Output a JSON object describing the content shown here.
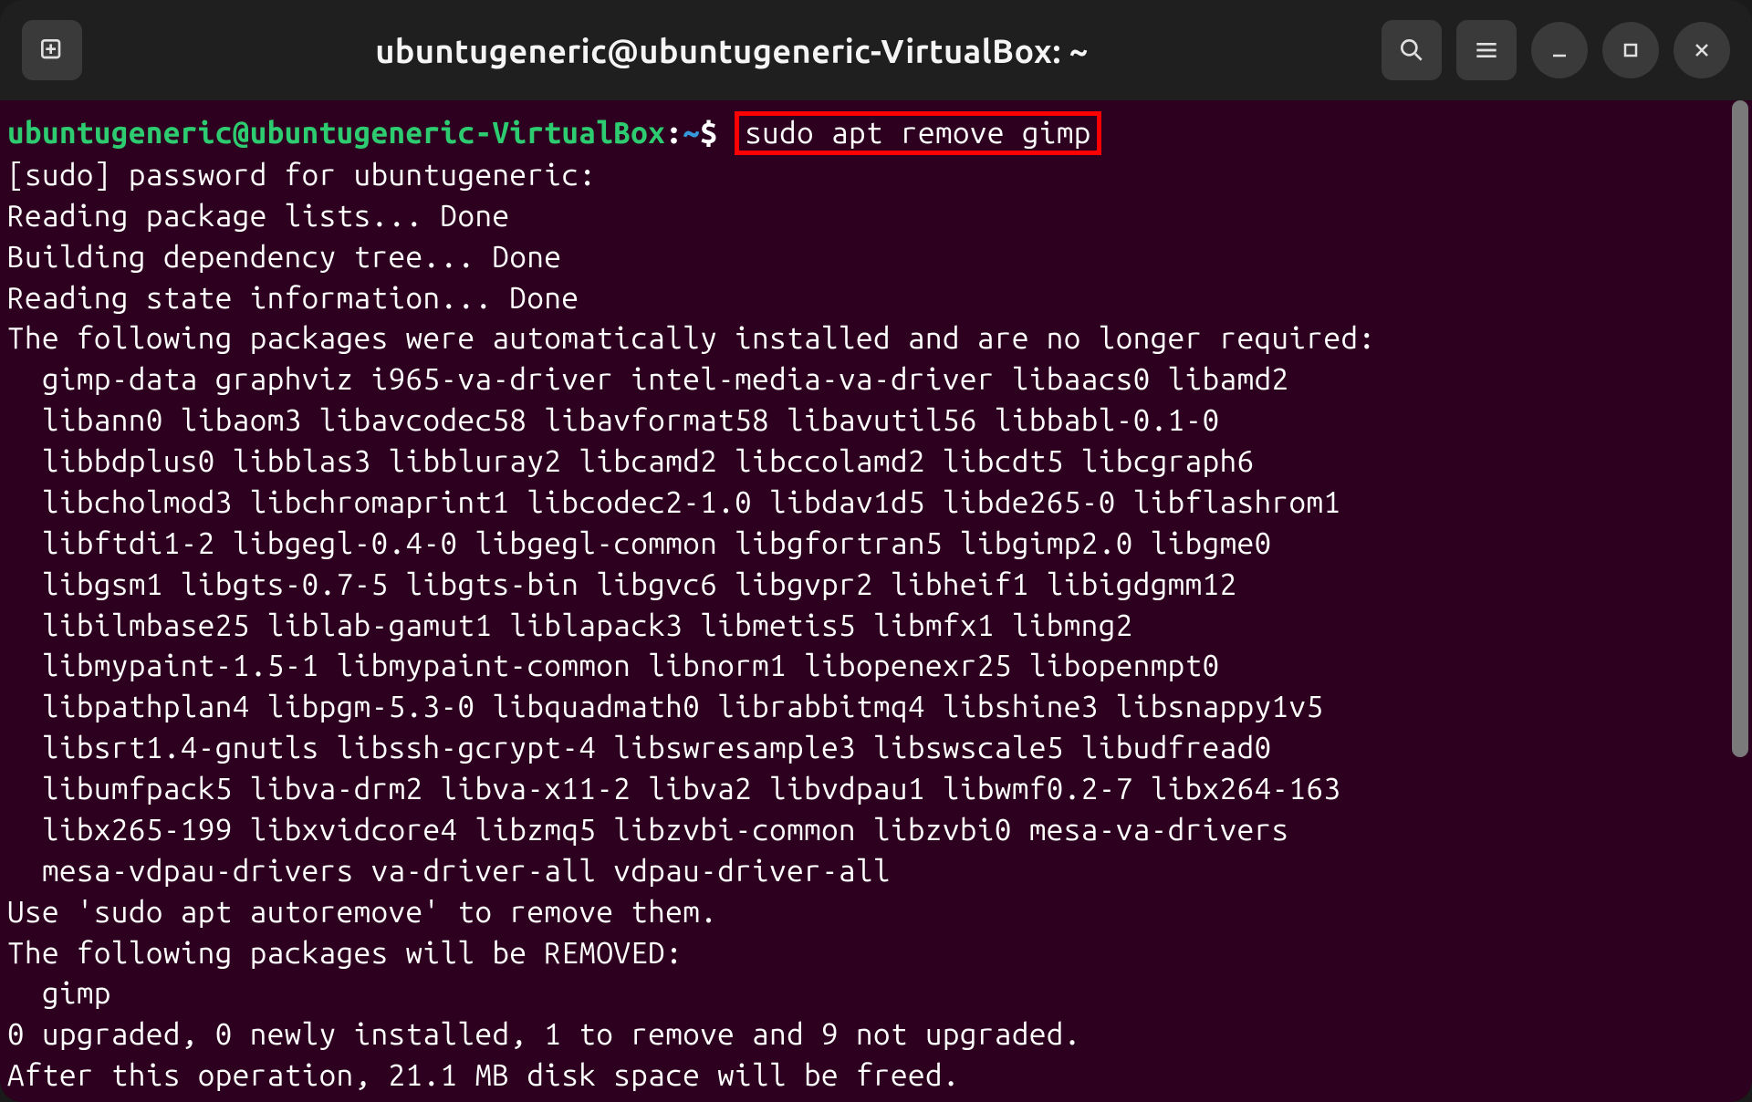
{
  "titlebar": {
    "title": "ubuntugeneric@ubuntugeneric-VirtualBox: ~"
  },
  "prompt": {
    "user_host": "ubuntugeneric@ubuntugeneric-VirtualBox",
    "colon": ":",
    "path": "~",
    "dollar": "$",
    "command": "sudo apt remove gimp"
  },
  "output": {
    "l1": "[sudo] password for ubuntugeneric:",
    "l2": "Reading package lists... Done",
    "l3": "Building dependency tree... Done",
    "l4": "Reading state information... Done",
    "l5": "The following packages were automatically installed and are no longer required:",
    "l6": "  gimp-data graphviz i965-va-driver intel-media-va-driver libaacs0 libamd2",
    "l7": "  libann0 libaom3 libavcodec58 libavformat58 libavutil56 libbabl-0.1-0",
    "l8": "  libbdplus0 libblas3 libbluray2 libcamd2 libccolamd2 libcdt5 libcgraph6",
    "l9": "  libcholmod3 libchromaprint1 libcodec2-1.0 libdav1d5 libde265-0 libflashrom1",
    "l10": "  libftdi1-2 libgegl-0.4-0 libgegl-common libgfortran5 libgimp2.0 libgme0",
    "l11": "  libgsm1 libgts-0.7-5 libgts-bin libgvc6 libgvpr2 libheif1 libigdgmm12",
    "l12": "  libilmbase25 liblab-gamut1 liblapack3 libmetis5 libmfx1 libmng2",
    "l13": "  libmypaint-1.5-1 libmypaint-common libnorm1 libopenexr25 libopenmpt0",
    "l14": "  libpathplan4 libpgm-5.3-0 libquadmath0 librabbitmq4 libshine3 libsnappy1v5",
    "l15": "  libsrt1.4-gnutls libssh-gcrypt-4 libswresample3 libswscale5 libudfread0",
    "l16": "  libumfpack5 libva-drm2 libva-x11-2 libva2 libvdpau1 libwmf0.2-7 libx264-163",
    "l17": "  libx265-199 libxvidcore4 libzmq5 libzvbi-common libzvbi0 mesa-va-drivers",
    "l18": "  mesa-vdpau-drivers va-driver-all vdpau-driver-all",
    "l19": "Use 'sudo apt autoremove' to remove them.",
    "l20": "The following packages will be REMOVED:",
    "l21": "  gimp",
    "l22": "0 upgraded, 0 newly installed, 1 to remove and 9 not upgraded.",
    "l23": "After this operation, 21.1 MB disk space will be freed."
  }
}
